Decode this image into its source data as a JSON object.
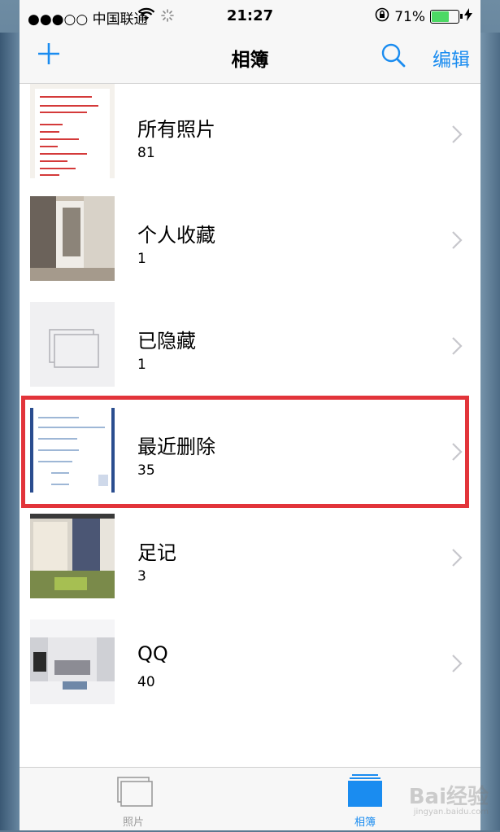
{
  "status_bar": {
    "carrier": "●●●○○ 中国联通",
    "time": "21:27",
    "battery_percent": "71%",
    "battery_level": 0.71
  },
  "nav": {
    "title": "相簿",
    "edit_label": "编辑",
    "add_icon": "plus-icon",
    "search_icon": "search-icon"
  },
  "albums": [
    {
      "name": "所有照片",
      "count": "81"
    },
    {
      "name": "个人收藏",
      "count": "1"
    },
    {
      "name": "已隐藏",
      "count": "1"
    },
    {
      "name": "最近删除",
      "count": "35"
    },
    {
      "name": "足记",
      "count": "3"
    },
    {
      "name": "QQ",
      "count": "40"
    }
  ],
  "highlighted_album": "最近删除",
  "tab_bar": {
    "photos_label": "照片",
    "albums_label": "相簿",
    "active": "相簿"
  },
  "watermark": {
    "brand": "Bai经验",
    "url": "jingyan.baidu.com"
  },
  "colors": {
    "accent": "#1a8cf0",
    "highlight": "#e2343a",
    "battery": "#4cd964"
  }
}
